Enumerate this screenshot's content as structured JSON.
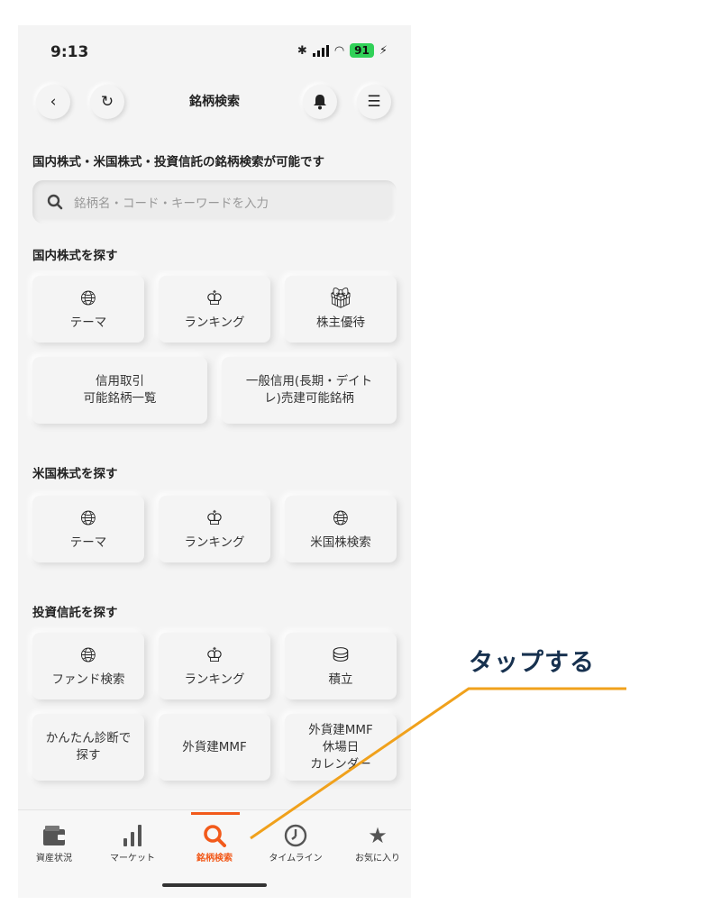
{
  "status": {
    "time": "9:13",
    "battery": "91"
  },
  "header": {
    "title": "銘柄検索"
  },
  "intro": "国内株式・米国株式・投資信託の銘柄検索が可能です",
  "search": {
    "placeholder": "銘柄名・コード・キーワードを入力"
  },
  "domestic": {
    "title": "国内株式を探す",
    "theme": "テーマ",
    "ranking": "ランキング",
    "benefits": "株主優待",
    "margin_line1": "信用取引",
    "margin_line2": "可能銘柄一覧",
    "general_line1": "一般信用(長期・デイト",
    "general_line2": "レ)売建可能銘柄"
  },
  "us": {
    "title": "米国株式を探す",
    "theme": "テーマ",
    "ranking": "ランキング",
    "search": "米国株検索"
  },
  "funds": {
    "title": "投資信託を探す",
    "fund_search": "ファンド検索",
    "ranking": "ランキング",
    "accumulate": "積立",
    "diag_line1": "かんたん診断で",
    "diag_line2": "探す",
    "mmf": "外貨建MMF",
    "holiday_line1": "外貨建MMF",
    "holiday_line2": "休場日",
    "holiday_line3": "カレンダー"
  },
  "tabs": {
    "assets": "資産状況",
    "market": "マーケット",
    "search": "銘柄検索",
    "timeline": "タイムライン",
    "favorites": "お気に入り"
  },
  "callout": "タップする",
  "colors": {
    "accent": "#f25a1b",
    "callout_text": "#17314f",
    "callout_line": "#f0a11c"
  }
}
